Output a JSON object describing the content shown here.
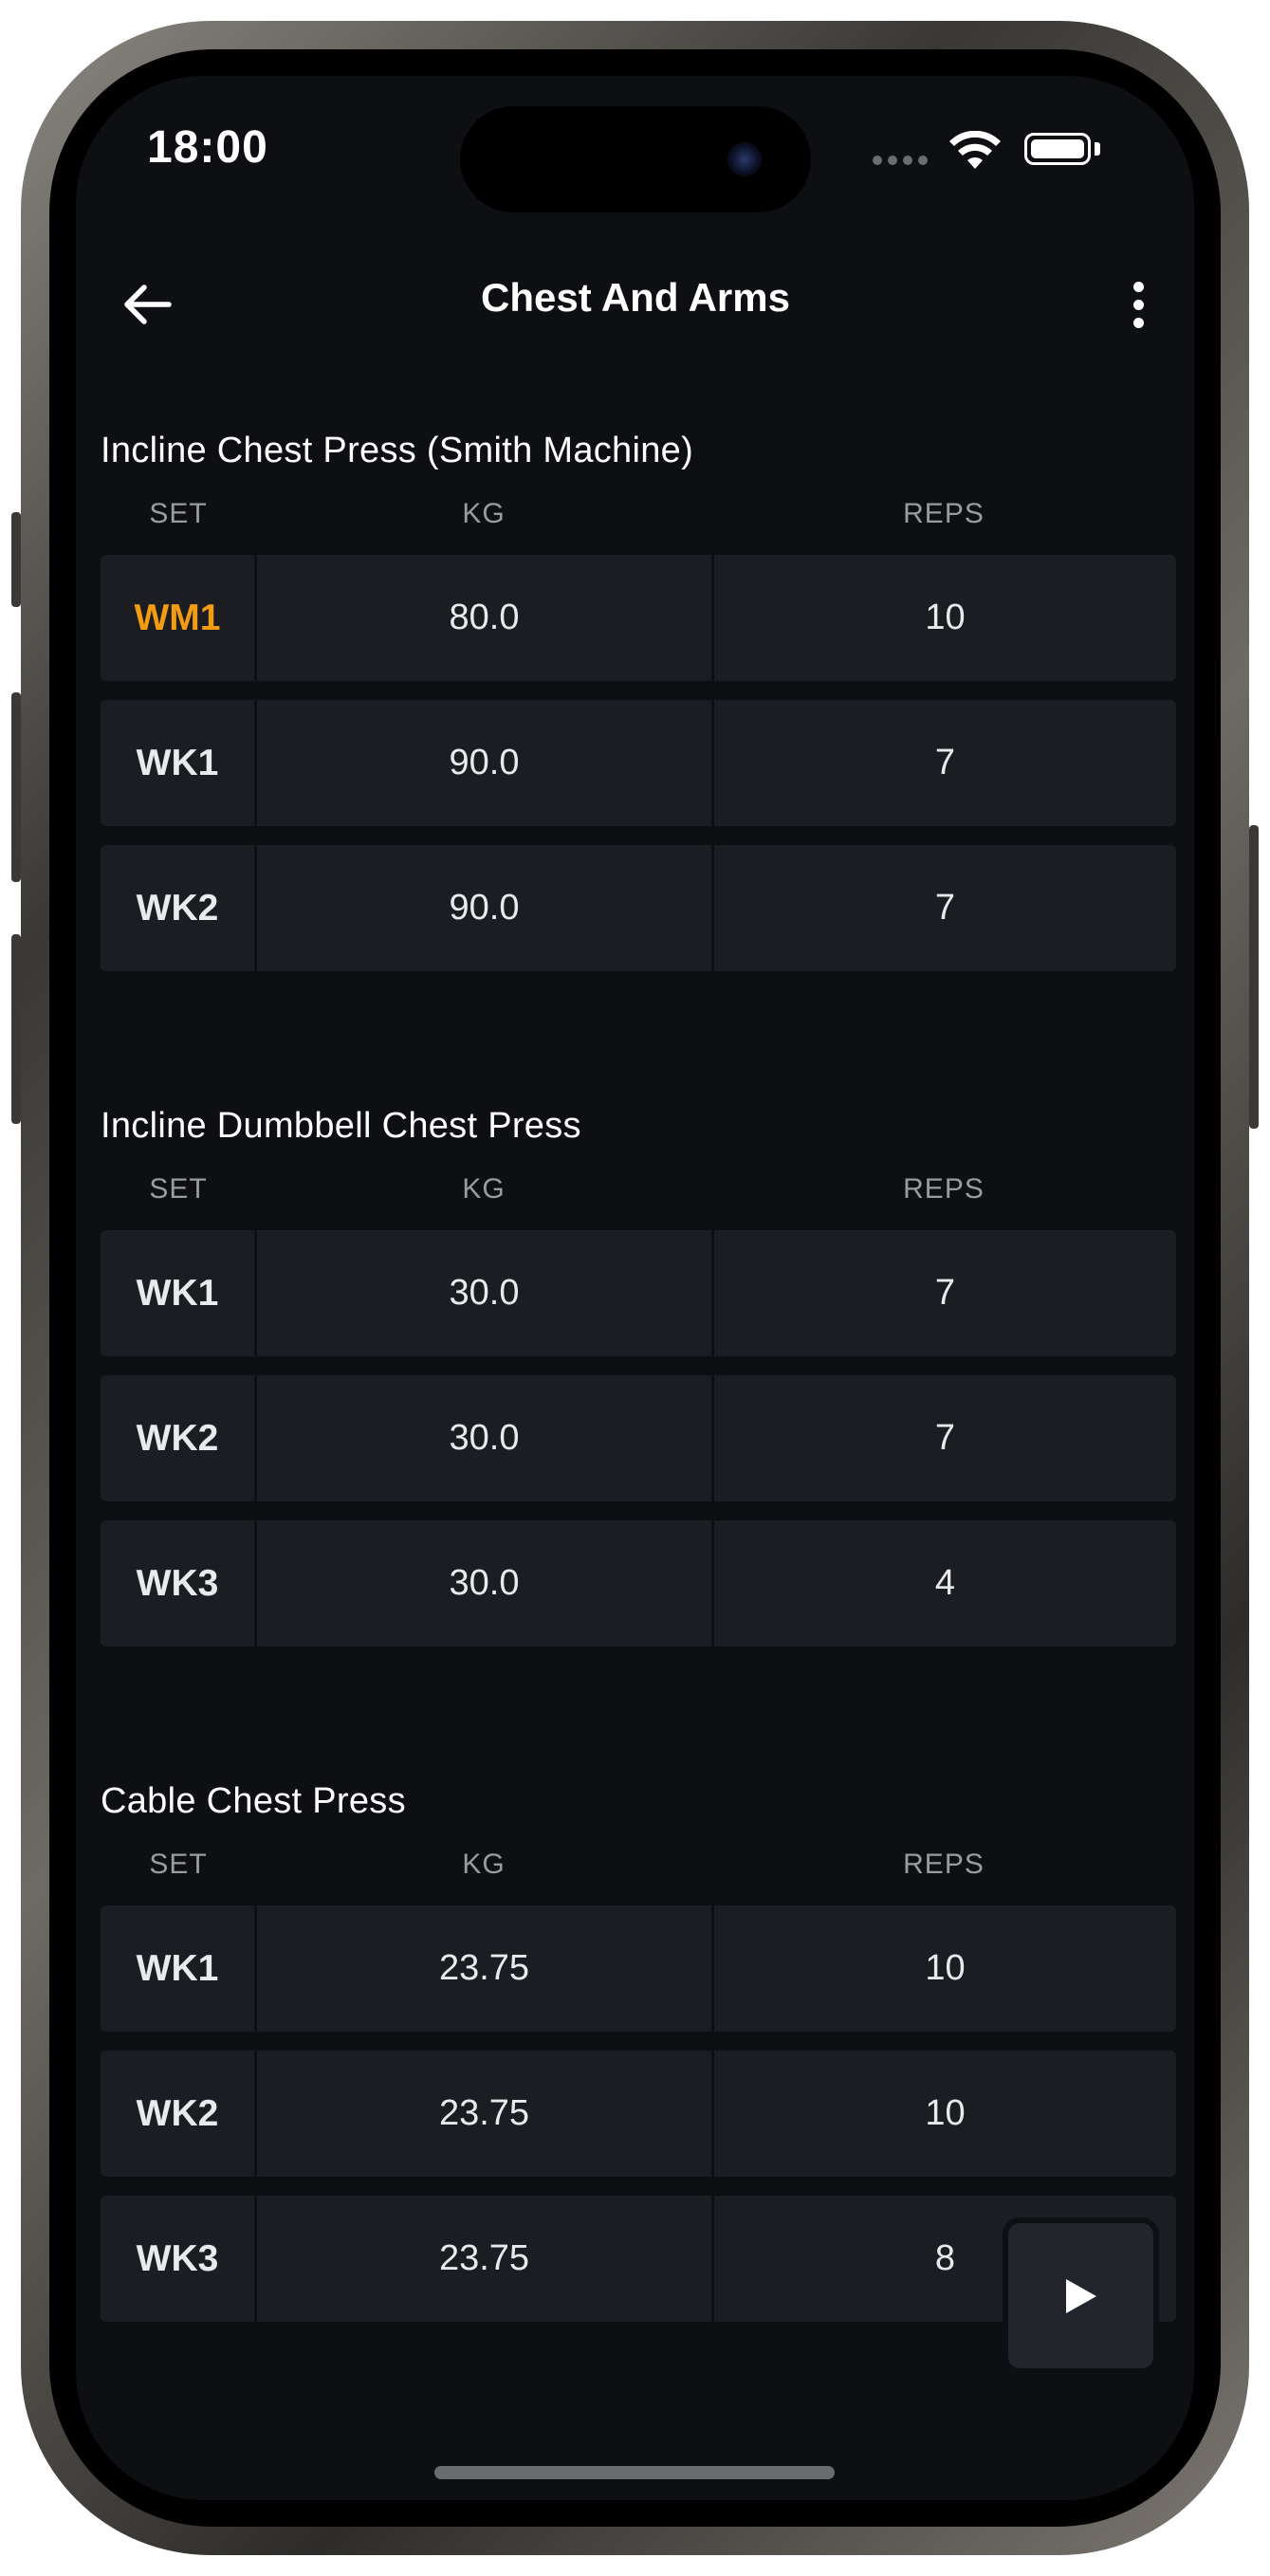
{
  "status_bar": {
    "time": "18:00"
  },
  "header": {
    "title": "Chest And Arms"
  },
  "columns": {
    "set": "SET",
    "kg": "KG",
    "reps": "REPS"
  },
  "colors": {
    "warmup": "#f39c12",
    "working": "#ffffff",
    "background": "#0e0f12",
    "row": "#1c1d23"
  },
  "exercises": [
    {
      "name": "Incline Chest Press (Smith Machine)",
      "sets": [
        {
          "set": "WM1",
          "kg": "80.0",
          "reps": "10",
          "type": "warmup"
        },
        {
          "set": "WK1",
          "kg": "90.0",
          "reps": "7",
          "type": "working"
        },
        {
          "set": "WK2",
          "kg": "90.0",
          "reps": "7",
          "type": "working"
        }
      ]
    },
    {
      "name": "Incline Dumbbell Chest Press",
      "sets": [
        {
          "set": "WK1",
          "kg": "30.0",
          "reps": "7",
          "type": "working"
        },
        {
          "set": "WK2",
          "kg": "30.0",
          "reps": "7",
          "type": "working"
        },
        {
          "set": "WK3",
          "kg": "30.0",
          "reps": "4",
          "type": "working"
        }
      ]
    },
    {
      "name": "Cable Chest Press",
      "sets": [
        {
          "set": "WK1",
          "kg": "23.75",
          "reps": "10",
          "type": "working"
        },
        {
          "set": "WK2",
          "kg": "23.75",
          "reps": "10",
          "type": "working"
        },
        {
          "set": "WK3",
          "kg": "23.75",
          "reps": "8",
          "type": "working"
        }
      ]
    }
  ],
  "icons": {
    "back": "arrow-left-icon",
    "more": "more-vertical-icon",
    "play": "play-icon",
    "wifi": "wifi-icon",
    "battery": "battery-icon"
  }
}
